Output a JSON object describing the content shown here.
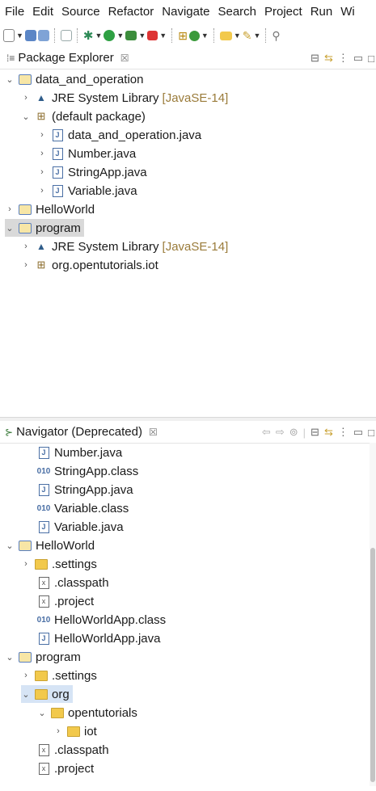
{
  "menubar": {
    "items": [
      "File",
      "Edit",
      "Source",
      "Refactor",
      "Navigate",
      "Search",
      "Project",
      "Run",
      "Wi"
    ]
  },
  "toolbar": {
    "icons": [
      "new-icon",
      "save-icon",
      "save-all-icon",
      "terminal-icon",
      "debug-icon",
      "run-icon",
      "coverage-icon",
      "external-tools-icon",
      "open-type-icon",
      "new-class-icon",
      "open-folder-icon",
      "pen-icon",
      "pin-icon"
    ]
  },
  "package_explorer": {
    "title": "Package Explorer",
    "close": "☒",
    "items": [
      {
        "twisty": "⌄",
        "icon": "project",
        "label": "data_and_operation",
        "deco": ""
      },
      {
        "twisty": "›",
        "icon": "library",
        "label": "JRE System Library",
        "deco": "[JavaSE-14]"
      },
      {
        "twisty": "⌄",
        "icon": "package",
        "label": "(default package)",
        "deco": ""
      },
      {
        "twisty": "›",
        "icon": "java",
        "label": "data_and_operation.java",
        "deco": ""
      },
      {
        "twisty": "›",
        "icon": "java",
        "label": "Number.java",
        "deco": ""
      },
      {
        "twisty": "›",
        "icon": "java",
        "label": "StringApp.java",
        "deco": ""
      },
      {
        "twisty": "›",
        "icon": "java",
        "label": "Variable.java",
        "deco": ""
      },
      {
        "twisty": "›",
        "icon": "project",
        "label": "HelloWorld",
        "deco": ""
      },
      {
        "twisty": "⌄",
        "icon": "project",
        "label": "program",
        "deco": ""
      },
      {
        "twisty": "›",
        "icon": "library",
        "label": "JRE System Library",
        "deco": "[JavaSE-14]"
      },
      {
        "twisty": "›",
        "icon": "package",
        "label": "org.opentutorials.iot",
        "deco": ""
      }
    ]
  },
  "navigator": {
    "title": "Navigator (Deprecated)",
    "close": "☒",
    "items": [
      {
        "twisty": "",
        "icon": "java",
        "label": "Number.java"
      },
      {
        "twisty": "",
        "icon": "class",
        "label": "StringApp.class"
      },
      {
        "twisty": "",
        "icon": "java",
        "label": "StringApp.java"
      },
      {
        "twisty": "",
        "icon": "class",
        "label": "Variable.class"
      },
      {
        "twisty": "",
        "icon": "java",
        "label": "Variable.java"
      },
      {
        "twisty": "⌄",
        "icon": "project",
        "label": "HelloWorld"
      },
      {
        "twisty": "›",
        "icon": "folder",
        "label": ".settings"
      },
      {
        "twisty": "",
        "icon": "xml",
        "label": ".classpath"
      },
      {
        "twisty": "",
        "icon": "xml",
        "label": ".project"
      },
      {
        "twisty": "",
        "icon": "class",
        "label": "HelloWorldApp.class"
      },
      {
        "twisty": "",
        "icon": "java",
        "label": "HelloWorldApp.java"
      },
      {
        "twisty": "⌄",
        "icon": "project",
        "label": "program"
      },
      {
        "twisty": "›",
        "icon": "folder",
        "label": ".settings"
      },
      {
        "twisty": "⌄",
        "icon": "folder",
        "label": "org"
      },
      {
        "twisty": "⌄",
        "icon": "folder",
        "label": "opentutorials"
      },
      {
        "twisty": "›",
        "icon": "folder",
        "label": "iot"
      },
      {
        "twisty": "",
        "icon": "xml",
        "label": ".classpath"
      },
      {
        "twisty": "",
        "icon": "xml",
        "label": ".project"
      }
    ]
  }
}
